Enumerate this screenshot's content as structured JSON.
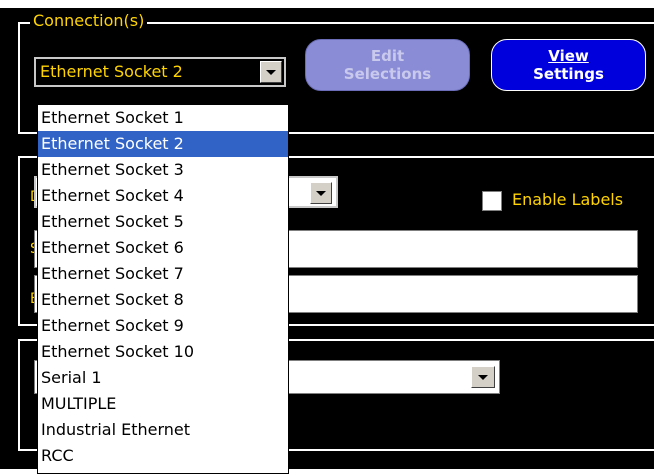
{
  "connections": {
    "legend": "Connection(s)",
    "selected_value": "Ethernet Socket 2",
    "edit_button": {
      "line1": "Edit",
      "line2": "Selections"
    },
    "view_button": {
      "line1": "View",
      "line2": "Settings"
    }
  },
  "enable_labels": {
    "label": "Enable Labels",
    "checked": false
  },
  "dropdown": {
    "items": [
      {
        "label": "Ethernet Socket 1"
      },
      {
        "label": "Ethernet Socket 2"
      },
      {
        "label": "Ethernet Socket 3"
      },
      {
        "label": "Ethernet Socket 4"
      },
      {
        "label": "Ethernet Socket 5"
      },
      {
        "label": "Ethernet Socket 6"
      },
      {
        "label": "Ethernet Socket 7"
      },
      {
        "label": "Ethernet Socket 8"
      },
      {
        "label": "Ethernet Socket 9"
      },
      {
        "label": "Ethernet Socket 10"
      },
      {
        "label": "Serial 1"
      },
      {
        "label": "MULTIPLE"
      },
      {
        "label": "Industrial Ethernet"
      },
      {
        "label": "RCC"
      }
    ],
    "selected_index": 1
  },
  "partial_labels": {
    "row1": "D",
    "row2": "S",
    "row3": "E"
  },
  "colors": {
    "background": "#000000",
    "label_text": "#ffd400",
    "selection_highlight": "#3163c6",
    "view_button": "#0000dd",
    "edit_button_disabled": "#8a8cd6"
  }
}
